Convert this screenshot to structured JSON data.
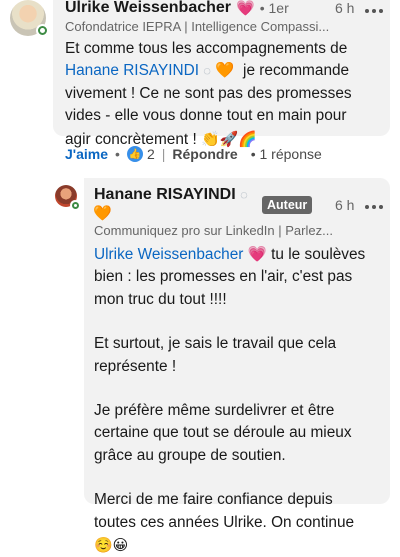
{
  "comment": {
    "author": "Ulrike Weissenbacher",
    "degree": "• 1er",
    "time": "6 h",
    "headline": "Cofondatrice IEPRA | Intelligence Compassi...",
    "text_1": "Et comme tous les accompagnements de",
    "mention": "Hanane RISAYINDI",
    "text_2": "je recommande",
    "text_3": "vivement ! Ce ne sont pas des promesses",
    "text_4": "vides - elle vous donne tout en main pour",
    "text_5": "agir concrètement !",
    "emojis_end": "👏🚀🌈"
  },
  "actions": {
    "like": "J'aime",
    "sep": "•",
    "reaction_count": "2",
    "divider": "|",
    "reply": "Répondre",
    "reply_count": "• 1 réponse"
  },
  "reply": {
    "author": "Hanane RISAYINDI",
    "badge": "Auteur",
    "time": "6 h",
    "headline": "Communiquez pro sur LinkedIn | Parlez...",
    "mention": "Ulrike Weissenbacher",
    "line_1": "tu le soulèves",
    "line_2": "bien : les promesses en l'air, c'est pas",
    "line_3": "mon truc du tout !!!!",
    "line_4": "Et surtout, je sais le travail que cela",
    "line_5": "représente !",
    "line_6": "Je préfère même surdelivrer et être",
    "line_7": "certaine que tout se déroule au mieux",
    "line_8": "grâce au groupe de soutien.",
    "line_9": "Merci de me faire confiance depuis",
    "line_10": "toutes ces années Ulrike. On continue",
    "emojis_end": "☺️😀"
  },
  "colors": {
    "link": "#0a66c2",
    "bubble": "#f2f2f2",
    "heart_purple": "#e879c6",
    "heart_orange": "#f08a24",
    "online": "#3d8b44"
  }
}
